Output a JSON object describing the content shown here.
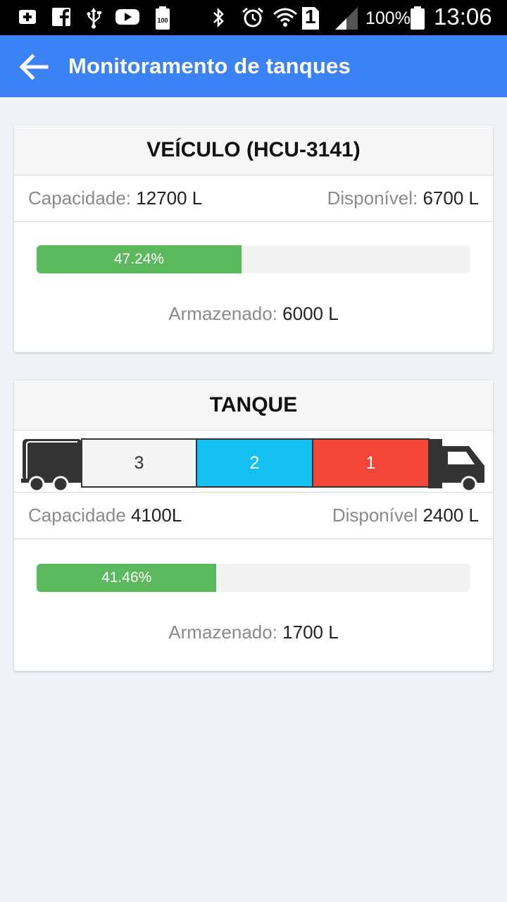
{
  "status_bar": {
    "battery_percent": "100%",
    "time": "13:06",
    "sim_slot": "1",
    "icons": [
      "add-box-icon",
      "facebook-icon",
      "usb-icon",
      "youtube-icon",
      "battery-saver-icon",
      "bluetooth-icon",
      "alarm-icon",
      "wifi-icon",
      "sim-icon",
      "signal-icon",
      "battery-icon"
    ]
  },
  "app_bar": {
    "title": "Monitoramento de tanques",
    "back_icon": "arrow-back-icon"
  },
  "vehicle_card": {
    "title": "VEÍCULO (HCU-3141)",
    "capacity_label": "Capacidade:",
    "capacity_value": "12700 L",
    "available_label": "Disponível:",
    "available_value": "6700 L",
    "progress_percent": 47.24,
    "progress_text": "47.24%",
    "stored_label": "Armazenado:",
    "stored_value": "6000 L"
  },
  "tank_card": {
    "title": "TANQUE",
    "compartments": [
      {
        "label": "3",
        "color": "#f5f5f5",
        "text_color": "#333333"
      },
      {
        "label": "2",
        "color": "#14c0f2",
        "text_color": "#ffffff"
      },
      {
        "label": "1",
        "color": "#f3463a",
        "text_color": "#ffffff"
      }
    ],
    "capacity_label": "Capacidade",
    "capacity_value": "4100L",
    "available_label": "Disponível",
    "available_value": "2400 L",
    "progress_percent": 41.46,
    "progress_text": "41.46%",
    "stored_label": "Armazenado:",
    "stored_value": "1700 L"
  },
  "colors": {
    "accent": "#3b82f6",
    "progress_green": "#5cb85c",
    "background": "#eff3f7",
    "truck_dark": "#333333"
  }
}
